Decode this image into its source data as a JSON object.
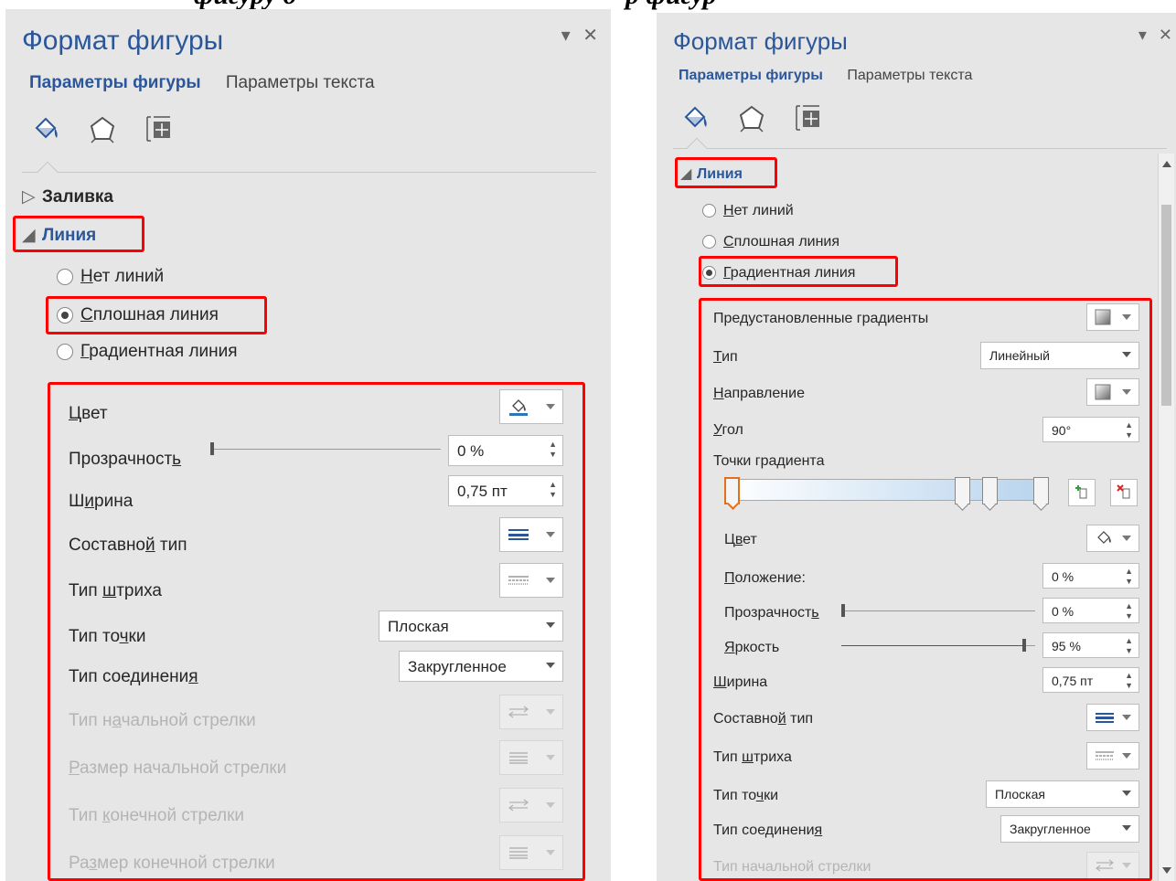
{
  "caption": {
    "left": "фигуру д",
    "right": "р фигур"
  },
  "left_pane": {
    "title": "Формат фигуры",
    "controls": {
      "dropdown": "▾",
      "close": "✕"
    },
    "tabs": [
      {
        "label": "Параметры фигуры",
        "active": true
      },
      {
        "label": "Параметры текста",
        "active": false
      }
    ],
    "icons": [
      "fill-line-icon",
      "effects-pentagon-icon",
      "size-layout-icon"
    ],
    "sections": {
      "fill": "Заливка",
      "line": "Линия"
    },
    "radios": {
      "none": {
        "pre": "",
        "u": "Н",
        "post": "ет линий"
      },
      "solid": {
        "pre": "",
        "u": "С",
        "post": "плошная линия"
      },
      "gradient": {
        "pre": "",
        "u": "Г",
        "post": "радиентная линия"
      }
    },
    "props": {
      "color": {
        "pre": "",
        "u": "Ц",
        "post": "вет"
      },
      "transparency": {
        "pre": "Прозрачност",
        "u": "ь",
        "post": "",
        "value": "0 %",
        "level": 0
      },
      "width": {
        "pre": "Ш",
        "u": "и",
        "post": "рина",
        "value": "0,75 пт"
      },
      "compound": {
        "pre": "Составно",
        "u": "й",
        "post": " тип"
      },
      "dash": {
        "pre": "Тип ",
        "u": "ш",
        "post": "триха"
      },
      "cap": {
        "pre": "Тип то",
        "u": "ч",
        "post": "ки",
        "value": "Плоская"
      },
      "join": {
        "pre": "Тип соединени",
        "u": "я",
        "post": "",
        "value": "Закругленное"
      },
      "begin_type": {
        "pre": "Тип н",
        "u": "а",
        "post": "чальной стрелки"
      },
      "begin_size": {
        "pre": "",
        "u": "Р",
        "post": "азмер начальной стрелки"
      },
      "end_type": {
        "pre": "Тип ",
        "u": "к",
        "post": "онечной стрелки"
      },
      "end_size": {
        "pre": "Ра",
        "u": "з",
        "post": "мер конечной стрелки"
      }
    }
  },
  "right_pane": {
    "title": "Формат фигуры",
    "controls": {
      "dropdown": "▾",
      "close": "✕"
    },
    "tabs": [
      {
        "label": "Параметры фигуры",
        "active": true
      },
      {
        "label": "Параметры текста",
        "active": false
      }
    ],
    "icons": [
      "fill-line-icon",
      "effects-pentagon-icon",
      "size-layout-icon"
    ],
    "sections": {
      "line": "Линия"
    },
    "radios": {
      "none": {
        "pre": "",
        "u": "Н",
        "post": "ет линий"
      },
      "solid": {
        "pre": "",
        "u": "С",
        "post": "плошная линия"
      },
      "gradient": {
        "pre": "",
        "u": "Г",
        "post": "радиентная линия"
      }
    },
    "props": {
      "preset": {
        "pre": "Пре",
        "u": "д",
        "post": "установленные градиенты"
      },
      "type": {
        "pre": "",
        "u": "Т",
        "post": "ип",
        "value": "Линейный"
      },
      "direction": {
        "pre": "",
        "u": "Н",
        "post": "аправление"
      },
      "angle": {
        "pre": "",
        "u": "У",
        "post": "гол",
        "value": "90°"
      },
      "stops_label": "Точки градиента",
      "stop_color": {
        "pre": "Ц",
        "u": "в",
        "post": "ет"
      },
      "position": {
        "pre": "",
        "u": "П",
        "post": "оложение:",
        "value": "0 %"
      },
      "transparency": {
        "pre": "Прозрачност",
        "u": "ь",
        "post": "",
        "value": "0 %",
        "level": 0
      },
      "brightness": {
        "pre": "",
        "u": "Я",
        "post": "ркость",
        "value": "95 %",
        "level": 0.95
      },
      "width": {
        "pre": "",
        "u": "Ш",
        "post": "ирина",
        "value": "0,75 пт"
      },
      "compound": {
        "pre": "Составно",
        "u": "й",
        "post": " тип"
      },
      "dash": {
        "pre": "Тип ",
        "u": "ш",
        "post": "триха"
      },
      "cap": {
        "pre": "Тип то",
        "u": "ч",
        "post": "ки",
        "value": "Плоская"
      },
      "join": {
        "pre": "Тип соединени",
        "u": "я",
        "post": "",
        "value": "Закругленное"
      },
      "begin_type": {
        "pre": "Тип начальной стрелки",
        "u": "",
        "post": ""
      }
    }
  },
  "colors": {
    "accent": "#2b579a",
    "highlight": "#ff0000",
    "selected_stop": "#e0701e",
    "pane_bg": "#e6e6e6"
  }
}
